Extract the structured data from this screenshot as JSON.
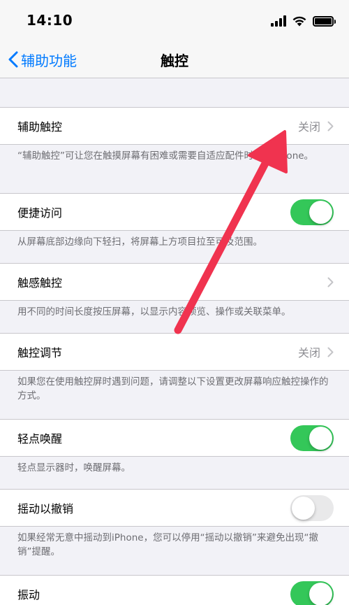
{
  "status_bar": {
    "time": "14:10"
  },
  "nav": {
    "back_label": "辅助功能",
    "title": "触控"
  },
  "cells": {
    "assistive_touch": {
      "label": "辅助触控",
      "value": "关闭"
    },
    "reachability": {
      "label": "便捷访问",
      "toggle": "on"
    },
    "haptic_touch": {
      "label": "触感触控"
    },
    "touch_accommodations": {
      "label": "触控调节",
      "value": "关闭"
    },
    "tap_to_wake": {
      "label": "轻点唤醒",
      "toggle": "on"
    },
    "shake_to_undo": {
      "label": "摇动以撤销",
      "toggle": "off"
    },
    "vibration": {
      "label": "振动",
      "toggle": "on"
    }
  },
  "footers": {
    "assistive_touch": "“辅助触控”可让您在触摸屏幕有困难或需要自适应配件时使用iPhone。",
    "reachability": "从屏幕底部边缘向下轻扫，将屏幕上方项目拉至可及范围。",
    "haptic_touch": "用不同的时间长度按压屏幕，以显示内容预览、操作或关联菜单。",
    "touch_accommodations": "如果您在使用触控屏时遇到问题，请调整以下设置更改屏幕响应触控操作的方式。",
    "tap_to_wake": "轻点显示器时，唤醒屏幕。",
    "shake_to_undo": "如果经常无意中摇动到iPhone，您可以停用“摇动以撤销”来避免出现“撤销”提醒。"
  },
  "colors": {
    "accent": "#007aff",
    "toggle_on": "#34c759",
    "arrow": "#f0334f"
  }
}
